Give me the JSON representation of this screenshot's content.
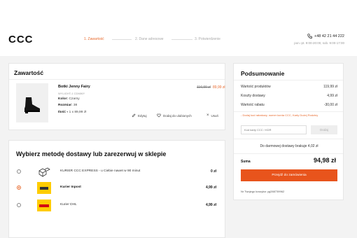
{
  "header": {
    "logo": "CCC",
    "steps": [
      "1. Zawartość",
      "2. Dane adresowe",
      "3. Potwierdzenie"
    ],
    "phone": "+48 42 21 44 222",
    "hours": "pon.-pt. 9:00-20:00, sob. 9:00-17:00"
  },
  "cart": {
    "title": "Zawartość",
    "item": {
      "name": "Botki Jenny Fairy",
      "brand": "WYLIGHT-1 CDMWY",
      "color_label": "Kolor:",
      "color_value": "Czarny",
      "size_label": "Rozmiar:",
      "size_value": "38",
      "qty_label": "Ilość",
      "qty_value": "1 x 89,99 zł",
      "old_price": "116,99 zł",
      "new_price": "89,99 zł",
      "image_icon": "ankle-boot-icon"
    },
    "actions": {
      "edit": "Edytuj",
      "favorite": "Dodaj do ulubionych",
      "remove": "Usuń"
    }
  },
  "delivery": {
    "title": "Wybierz metodę dostawy lub zarezerwuj w sklepie",
    "options": [
      {
        "name": "KURIER CCC EXPRESS - u Ciebie nawet w 90 minut",
        "price": "0 zł",
        "selected": false,
        "icon": "boxes-icon",
        "bold": false
      },
      {
        "name": "Kurier Inpost",
        "price": "4,99 zł",
        "selected": true,
        "icon": "inpost-logo",
        "bold": true
      },
      {
        "name": "Kurier DHL",
        "price": "4,99 zł",
        "selected": false,
        "icon": "dhl-logo",
        "bold": false
      }
    ]
  },
  "summary": {
    "title": "Podsumowanie",
    "rows": [
      {
        "label": "Wartość produktów",
        "value": "119,99 zł"
      },
      {
        "label": "Koszty dostawy",
        "value": "4,99 zł"
      },
      {
        "label": "Wartość rabatu",
        "value": "-30,00 zł"
      }
    ],
    "promo_note": "- Dodaj kod rabatowy, numer konta CCC, Karty Dużej Rodziny",
    "promo_placeholder": "Kod karty CCC / KDR",
    "promo_button": "Dodaj",
    "free_shipping": "Do darmowej dostawy brakuje 4,02 zł",
    "total_label": "Suma",
    "total_value": "94,98 zł",
    "checkout_button": "Przejdź do zamówienia",
    "cart_number": "Nr Twojego koszyka: yg288739962"
  },
  "colors": {
    "accent": "#e8692c",
    "checkout": "#e8541c",
    "background": "#f3f3f3"
  }
}
